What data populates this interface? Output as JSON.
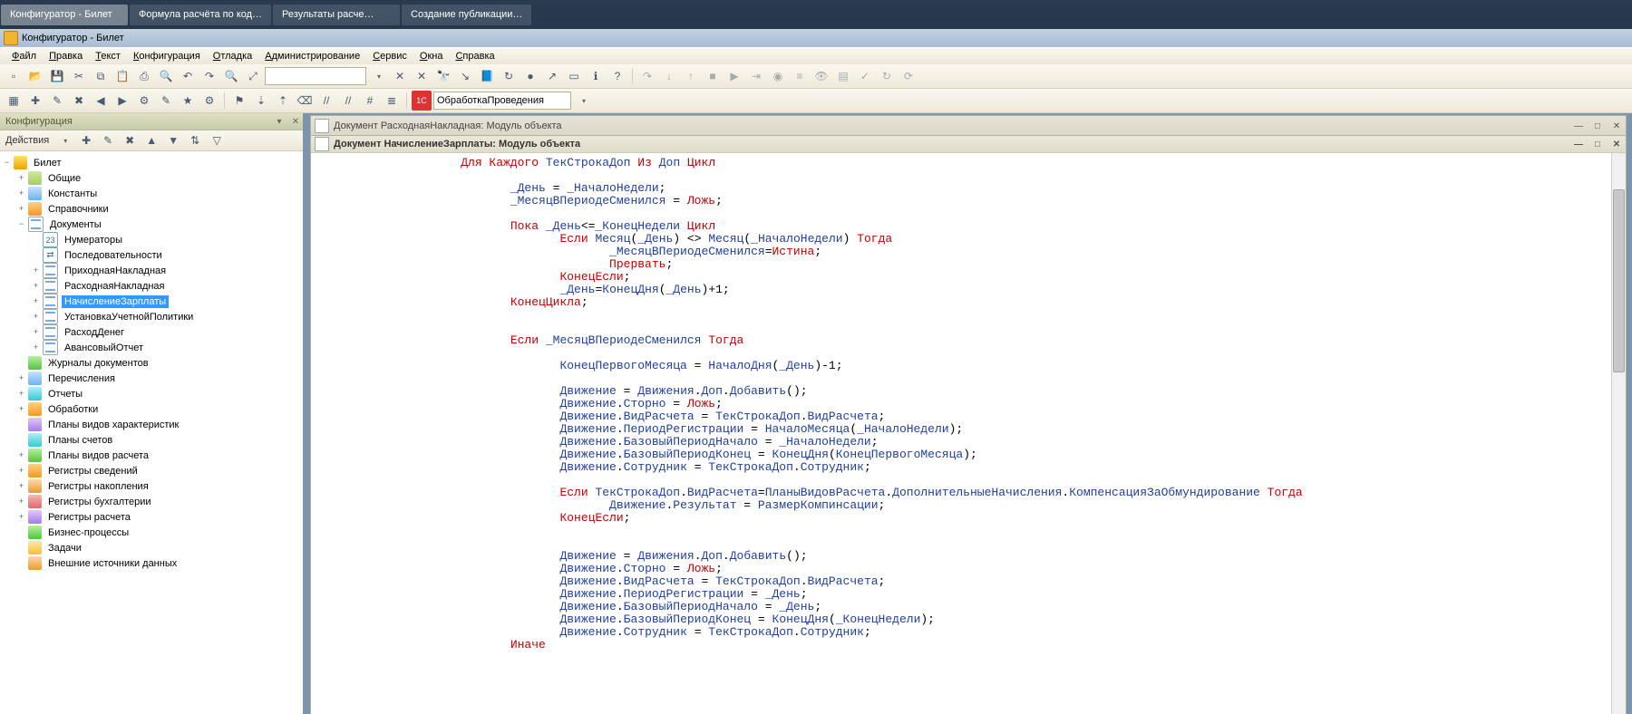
{
  "taskbar": {
    "tabs": [
      {
        "label": "Конфигуратор - Билет",
        "active": true
      },
      {
        "label": "Формула расчёта по код…",
        "active": false
      },
      {
        "label": "Результаты расче…",
        "active": false
      },
      {
        "label": "Создание публикации…",
        "active": false
      }
    ]
  },
  "window_title": "Конфигуратор - Билет",
  "menus": [
    "Файл",
    "Правка",
    "Текст",
    "Конфигурация",
    "Отладка",
    "Администрирование",
    "Сервис",
    "Окна",
    "Справка"
  ],
  "toolbar1_icons": [
    "new-icon",
    "open-icon",
    "save-icon",
    "cut-icon",
    "copy-icon",
    "paste-icon",
    "print-icon",
    "print-preview-icon",
    "undo-icon",
    "redo-icon",
    "find-icon",
    "zoom-icon"
  ],
  "search_box": "",
  "toolbar1_icons_right": [
    "clear-search-icon",
    "binoculars-icon",
    "goto-icon",
    "book-icon",
    "refresh-icon",
    "blue-dot-icon",
    "pointer-icon",
    "script-box-icon",
    "info-icon",
    "help-icon"
  ],
  "debug_icons": [
    "step-over-icon",
    "step-into-icon",
    "step-out-icon",
    "stop-icon",
    "continue-icon",
    "run-to-icon",
    "breakpoint-icon",
    "breakpoints-list-icon",
    "watch-icon",
    "output-icon",
    "syntax-check-icon",
    "refresh-icon",
    "restart-icon"
  ],
  "toolbar2_icons_left": [
    "grid-icon",
    "doc-new-icon",
    "doc-open-icon",
    "doc-remove-icon",
    "arrow-left-icon",
    "arrow-right-icon",
    "params-icon",
    "edit-icon",
    "wizard-icon",
    "config-icon"
  ],
  "toolbar2_icons_mid": [
    "bookmark-toggle-icon",
    "bookmark-next-icon",
    "bookmark-prev-icon",
    "bookmark-clear-icon",
    "comment-icon",
    "uncomment-icon",
    "goto-line-icon",
    "proc-list-icon"
  ],
  "proc_dropdown_badge": "1С",
  "proc_dropdown": "ОбработкаПроведения",
  "panel": {
    "title": "Конфигурация",
    "actions_label": "Действия"
  },
  "panel_toolbar_icons": [
    "add-icon",
    "edit-icon",
    "delete-icon",
    "up-icon",
    "down-icon",
    "sort-icon",
    "filter-icon"
  ],
  "tree": [
    {
      "depth": 1,
      "exp": "minus",
      "icon": "i-root",
      "label": "Билет"
    },
    {
      "depth": 2,
      "exp": "plus",
      "icon": "i-folder",
      "label": "Общие"
    },
    {
      "depth": 2,
      "exp": "plus",
      "icon": "i-blue",
      "label": "Константы"
    },
    {
      "depth": 2,
      "exp": "plus",
      "icon": "i-orange",
      "label": "Справочники"
    },
    {
      "depth": 2,
      "exp": "minus",
      "icon": "i-doc",
      "label": "Документы"
    },
    {
      "depth": 3,
      "exp": "none",
      "icon": "i-num",
      "label": "Нумераторы"
    },
    {
      "depth": 3,
      "exp": "none",
      "icon": "i-arrow",
      "label": "Последовательности"
    },
    {
      "depth": 3,
      "exp": "plus",
      "icon": "i-doc",
      "label": "ПриходнаяНакладная"
    },
    {
      "depth": 3,
      "exp": "plus",
      "icon": "i-doc",
      "label": "РасходнаяНакладная"
    },
    {
      "depth": 3,
      "exp": "plus",
      "icon": "i-doc",
      "label": "НачислениеЗарплаты",
      "selected": true
    },
    {
      "depth": 3,
      "exp": "plus",
      "icon": "i-doc",
      "label": "УстановкаУчетнойПолитики"
    },
    {
      "depth": 3,
      "exp": "plus",
      "icon": "i-doc",
      "label": "РасходДенег"
    },
    {
      "depth": 3,
      "exp": "plus",
      "icon": "i-doc",
      "label": "АвансовыйОтчет"
    },
    {
      "depth": 2,
      "exp": "none",
      "icon": "i-green",
      "label": "Журналы документов"
    },
    {
      "depth": 2,
      "exp": "plus",
      "icon": "i-blue",
      "label": "Перечисления"
    },
    {
      "depth": 2,
      "exp": "plus",
      "icon": "i-cyan",
      "label": "Отчеты"
    },
    {
      "depth": 2,
      "exp": "plus",
      "icon": "i-orange",
      "label": "Обработки"
    },
    {
      "depth": 2,
      "exp": "none",
      "icon": "i-purple",
      "label": "Планы видов характеристик"
    },
    {
      "depth": 2,
      "exp": "none",
      "icon": "i-cyan",
      "label": "Планы счетов"
    },
    {
      "depth": 2,
      "exp": "plus",
      "icon": "i-green",
      "label": "Планы видов расчета"
    },
    {
      "depth": 2,
      "exp": "plus",
      "icon": "i-orange",
      "label": "Регистры сведений"
    },
    {
      "depth": 2,
      "exp": "plus",
      "icon": "i-db",
      "label": "Регистры накопления"
    },
    {
      "depth": 2,
      "exp": "plus",
      "icon": "i-red",
      "label": "Регистры бухгалтерии"
    },
    {
      "depth": 2,
      "exp": "plus",
      "icon": "i-purple",
      "label": "Регистры расчета"
    },
    {
      "depth": 2,
      "exp": "none",
      "icon": "i-green",
      "label": "Бизнес-процессы"
    },
    {
      "depth": 2,
      "exp": "none",
      "icon": "i-task",
      "label": "Задачи"
    },
    {
      "depth": 2,
      "exp": "none",
      "icon": "i-db",
      "label": "Внешние источники данных"
    }
  ],
  "back_doc_title": "Документ РасходнаяНакладная: Модуль объекта",
  "editor_title": "Документ НачислениеЗарплаты: Модуль объекта",
  "code": [
    {
      "indent": 2,
      "tokens": [
        [
          "kw",
          "Для Каждого"
        ],
        [
          "lit",
          " "
        ],
        [
          "id",
          "ТекСтрокаДоп"
        ],
        [
          "lit",
          " "
        ],
        [
          "kw",
          "Из"
        ],
        [
          "lit",
          " "
        ],
        [
          "id",
          "Доп"
        ],
        [
          "lit",
          " "
        ],
        [
          "kw",
          "Цикл"
        ]
      ]
    },
    {
      "indent": 0,
      "tokens": []
    },
    {
      "indent": 3,
      "tokens": [
        [
          "id",
          "_День"
        ],
        [
          "lit",
          " = "
        ],
        [
          "id",
          "_НачалоНедели"
        ],
        [
          "lit",
          ";"
        ]
      ]
    },
    {
      "indent": 3,
      "tokens": [
        [
          "id",
          "_МесяцВПериодеСменился"
        ],
        [
          "lit",
          " = "
        ],
        [
          "kw",
          "Ложь"
        ],
        [
          "lit",
          ";"
        ]
      ]
    },
    {
      "indent": 0,
      "tokens": []
    },
    {
      "indent": 3,
      "tokens": [
        [
          "kw",
          "Пока"
        ],
        [
          "lit",
          " "
        ],
        [
          "id",
          "_День"
        ],
        [
          "lit",
          "<="
        ],
        [
          "id",
          "_КонецНедели"
        ],
        [
          "lit",
          " "
        ],
        [
          "kw",
          "Цикл"
        ]
      ]
    },
    {
      "indent": 4,
      "tokens": [
        [
          "kw",
          "Если"
        ],
        [
          "lit",
          " "
        ],
        [
          "id",
          "Месяц"
        ],
        [
          "lit",
          "("
        ],
        [
          "id",
          "_День"
        ],
        [
          "lit",
          ") <> "
        ],
        [
          "id",
          "Месяц"
        ],
        [
          "lit",
          "("
        ],
        [
          "id",
          "_НачалоНедели"
        ],
        [
          "lit",
          ") "
        ],
        [
          "kw",
          "Тогда"
        ]
      ]
    },
    {
      "indent": 5,
      "tokens": [
        [
          "id",
          "_МесяцВПериодеСменился"
        ],
        [
          "lit",
          "="
        ],
        [
          "kw",
          "Истина"
        ],
        [
          "lit",
          ";"
        ]
      ]
    },
    {
      "indent": 5,
      "tokens": [
        [
          "kw",
          "Прервать"
        ],
        [
          "lit",
          ";"
        ]
      ]
    },
    {
      "indent": 4,
      "tokens": [
        [
          "kw",
          "КонецЕсли"
        ],
        [
          "lit",
          ";"
        ]
      ]
    },
    {
      "indent": 4,
      "tokens": [
        [
          "id",
          "_День"
        ],
        [
          "lit",
          "="
        ],
        [
          "id",
          "КонецДня"
        ],
        [
          "lit",
          "("
        ],
        [
          "id",
          "_День"
        ],
        [
          "lit",
          ")+1;"
        ]
      ]
    },
    {
      "indent": 3,
      "tokens": [
        [
          "kw",
          "КонецЦикла"
        ],
        [
          "lit",
          ";"
        ]
      ]
    },
    {
      "indent": 0,
      "tokens": []
    },
    {
      "indent": 0,
      "tokens": []
    },
    {
      "indent": 3,
      "tokens": [
        [
          "kw",
          "Если"
        ],
        [
          "lit",
          " "
        ],
        [
          "id",
          "_МесяцВПериодеСменился"
        ],
        [
          "lit",
          " "
        ],
        [
          "kw",
          "Тогда"
        ]
      ]
    },
    {
      "indent": 0,
      "tokens": []
    },
    {
      "indent": 4,
      "tokens": [
        [
          "id",
          "КонецПервогоМесяца"
        ],
        [
          "lit",
          " = "
        ],
        [
          "id",
          "НачалоДня"
        ],
        [
          "lit",
          "("
        ],
        [
          "id",
          "_День"
        ],
        [
          "lit",
          ")-1;"
        ]
      ]
    },
    {
      "indent": 0,
      "tokens": []
    },
    {
      "indent": 4,
      "tokens": [
        [
          "id",
          "Движение"
        ],
        [
          "lit",
          " = "
        ],
        [
          "id",
          "Движения"
        ],
        [
          "lit",
          "."
        ],
        [
          "id",
          "Доп"
        ],
        [
          "lit",
          "."
        ],
        [
          "id",
          "Добавить"
        ],
        [
          "lit",
          "();"
        ]
      ]
    },
    {
      "indent": 4,
      "tokens": [
        [
          "id",
          "Движение"
        ],
        [
          "lit",
          "."
        ],
        [
          "id",
          "Сторно"
        ],
        [
          "lit",
          " = "
        ],
        [
          "kw",
          "Ложь"
        ],
        [
          "lit",
          ";"
        ]
      ]
    },
    {
      "indent": 4,
      "tokens": [
        [
          "id",
          "Движение"
        ],
        [
          "lit",
          "."
        ],
        [
          "id",
          "ВидРасчета"
        ],
        [
          "lit",
          " = "
        ],
        [
          "id",
          "ТекСтрокаДоп"
        ],
        [
          "lit",
          "."
        ],
        [
          "id",
          "ВидРасчета"
        ],
        [
          "lit",
          ";"
        ]
      ]
    },
    {
      "indent": 4,
      "tokens": [
        [
          "id",
          "Движение"
        ],
        [
          "lit",
          "."
        ],
        [
          "id",
          "ПериодРегистрации"
        ],
        [
          "lit",
          " = "
        ],
        [
          "id",
          "НачалоМесяца"
        ],
        [
          "lit",
          "("
        ],
        [
          "id",
          "_НачалоНедели"
        ],
        [
          "lit",
          ");"
        ]
      ]
    },
    {
      "indent": 4,
      "tokens": [
        [
          "id",
          "Движение"
        ],
        [
          "lit",
          "."
        ],
        [
          "id",
          "БазовыйПериодНачало"
        ],
        [
          "lit",
          " = "
        ],
        [
          "id",
          "_НачалоНедели"
        ],
        [
          "lit",
          ";"
        ]
      ]
    },
    {
      "indent": 4,
      "tokens": [
        [
          "id",
          "Движение"
        ],
        [
          "lit",
          "."
        ],
        [
          "id",
          "БазовыйПериодКонец"
        ],
        [
          "lit",
          " = "
        ],
        [
          "id",
          "КонецДня"
        ],
        [
          "lit",
          "("
        ],
        [
          "id",
          "КонецПервогоМесяца"
        ],
        [
          "lit",
          ");"
        ]
      ]
    },
    {
      "indent": 4,
      "tokens": [
        [
          "id",
          "Движение"
        ],
        [
          "lit",
          "."
        ],
        [
          "id",
          "Сотрудник"
        ],
        [
          "lit",
          " = "
        ],
        [
          "id",
          "ТекСтрокаДоп"
        ],
        [
          "lit",
          "."
        ],
        [
          "id",
          "Сотрудник"
        ],
        [
          "lit",
          ";"
        ]
      ]
    },
    {
      "indent": 0,
      "tokens": []
    },
    {
      "indent": 4,
      "tokens": [
        [
          "kw",
          "Если"
        ],
        [
          "lit",
          " "
        ],
        [
          "id",
          "ТекСтрокаДоп"
        ],
        [
          "lit",
          "."
        ],
        [
          "id",
          "ВидРасчета"
        ],
        [
          "lit",
          "="
        ],
        [
          "id",
          "ПланыВидовРасчета"
        ],
        [
          "lit",
          "."
        ],
        [
          "id",
          "ДополнительныеНачисления"
        ],
        [
          "lit",
          "."
        ],
        [
          "id",
          "КомпенсацияЗаОбмундирование"
        ],
        [
          "lit",
          " "
        ],
        [
          "kw",
          "Тогда"
        ]
      ]
    },
    {
      "indent": 5,
      "tokens": [
        [
          "id",
          "Движение"
        ],
        [
          "lit",
          "."
        ],
        [
          "id",
          "Результат"
        ],
        [
          "lit",
          " = "
        ],
        [
          "id",
          "РазмерКомпинсации"
        ],
        [
          "lit",
          ";"
        ]
      ]
    },
    {
      "indent": 4,
      "tokens": [
        [
          "kw",
          "КонецЕсли"
        ],
        [
          "lit",
          ";"
        ]
      ]
    },
    {
      "indent": 0,
      "tokens": []
    },
    {
      "indent": 0,
      "tokens": []
    },
    {
      "indent": 4,
      "tokens": [
        [
          "id",
          "Движение"
        ],
        [
          "lit",
          " = "
        ],
        [
          "id",
          "Движения"
        ],
        [
          "lit",
          "."
        ],
        [
          "id",
          "Доп"
        ],
        [
          "lit",
          "."
        ],
        [
          "id",
          "Добавить"
        ],
        [
          "lit",
          "();"
        ]
      ]
    },
    {
      "indent": 4,
      "tokens": [
        [
          "id",
          "Движение"
        ],
        [
          "lit",
          "."
        ],
        [
          "id",
          "Сторно"
        ],
        [
          "lit",
          " = "
        ],
        [
          "kw",
          "Ложь"
        ],
        [
          "lit",
          ";"
        ]
      ]
    },
    {
      "indent": 4,
      "tokens": [
        [
          "id",
          "Движение"
        ],
        [
          "lit",
          "."
        ],
        [
          "id",
          "ВидРасчета"
        ],
        [
          "lit",
          " = "
        ],
        [
          "id",
          "ТекСтрокаДоп"
        ],
        [
          "lit",
          "."
        ],
        [
          "id",
          "ВидРасчета"
        ],
        [
          "lit",
          ";"
        ]
      ]
    },
    {
      "indent": 4,
      "tokens": [
        [
          "id",
          "Движение"
        ],
        [
          "lit",
          "."
        ],
        [
          "id",
          "ПериодРегистрации"
        ],
        [
          "lit",
          " = "
        ],
        [
          "id",
          "_День"
        ],
        [
          "lit",
          ";"
        ]
      ]
    },
    {
      "indent": 4,
      "tokens": [
        [
          "id",
          "Движение"
        ],
        [
          "lit",
          "."
        ],
        [
          "id",
          "БазовыйПериодНачало"
        ],
        [
          "lit",
          " = "
        ],
        [
          "id",
          "_День"
        ],
        [
          "lit",
          ";"
        ]
      ]
    },
    {
      "indent": 4,
      "tokens": [
        [
          "id",
          "Движение"
        ],
        [
          "lit",
          "."
        ],
        [
          "id",
          "БазовыйПериодКонец"
        ],
        [
          "lit",
          " = "
        ],
        [
          "id",
          "КонецДня"
        ],
        [
          "lit",
          "("
        ],
        [
          "id",
          "_КонецНедели"
        ],
        [
          "lit",
          ");"
        ]
      ]
    },
    {
      "indent": 4,
      "tokens": [
        [
          "id",
          "Движение"
        ],
        [
          "lit",
          "."
        ],
        [
          "id",
          "Сотрудник"
        ],
        [
          "lit",
          " = "
        ],
        [
          "id",
          "ТекСтрокаДоп"
        ],
        [
          "lit",
          "."
        ],
        [
          "id",
          "Сотрудник"
        ],
        [
          "lit",
          ";"
        ]
      ]
    },
    {
      "indent": 3,
      "tokens": [
        [
          "kw",
          "Иначе"
        ]
      ]
    },
    {
      "indent": 0,
      "tokens": []
    }
  ]
}
